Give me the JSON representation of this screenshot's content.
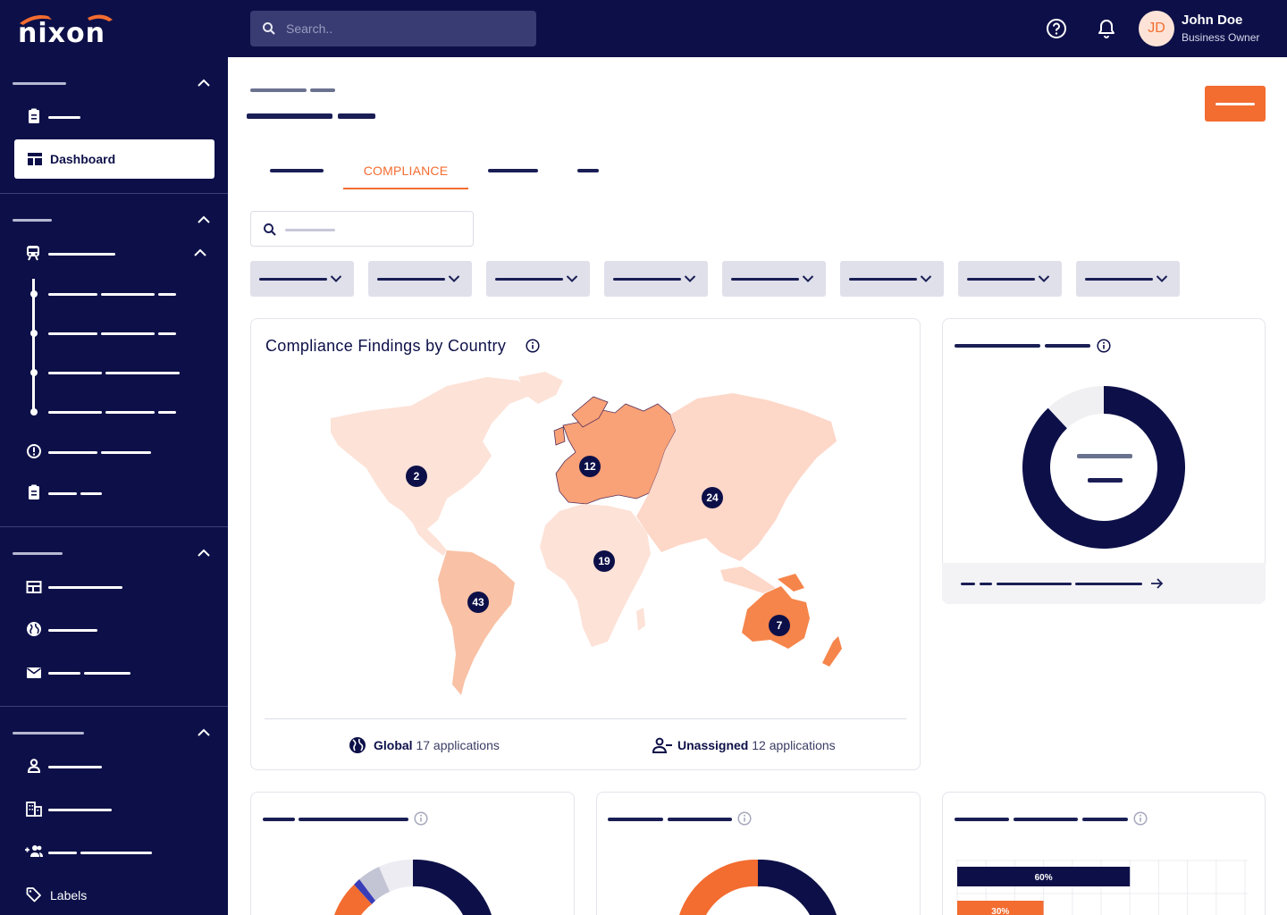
{
  "brand": {
    "logo_text": "nixon",
    "accent": "#f36c30",
    "navy": "#0d1048"
  },
  "header": {
    "search_placeholder": "Search..",
    "help_icon": "help-circle-icon",
    "notifications_icon": "bell-icon",
    "user": {
      "initials": "JD",
      "name": "John Doe",
      "role": "Business Owner"
    }
  },
  "sidebar": {
    "active_item": "Dashboard",
    "last_item": "Labels"
  },
  "tabs": {
    "active": "COMPLIANCE"
  },
  "map_card": {
    "title": "Compliance Findings by Country",
    "markers": [
      {
        "region": "North America",
        "count": "2"
      },
      {
        "region": "Europe",
        "count": "12"
      },
      {
        "region": "Asia",
        "count": "24"
      },
      {
        "region": "Africa",
        "count": "19"
      },
      {
        "region": "South America",
        "count": "43"
      },
      {
        "region": "Australia",
        "count": "7"
      }
    ],
    "footer": {
      "global_label": "Global",
      "global_value": "17 applications",
      "unassigned_label": "Unassigned",
      "unassigned_value": "12 applications"
    }
  },
  "chart_data": [
    {
      "type": "pie",
      "title": "",
      "values": [
        0.88,
        0.12
      ],
      "colors": [
        "#0d1048",
        "#f0f0f3"
      ]
    },
    {
      "type": "bar",
      "orientation": "horizontal",
      "title": "",
      "categories": [
        "",
        ""
      ],
      "values": [
        60,
        30
      ],
      "labels": [
        "60%",
        "30%"
      ],
      "colors": [
        "#0d1048",
        "#f36c30"
      ],
      "xlim": [
        0,
        100
      ]
    }
  ]
}
